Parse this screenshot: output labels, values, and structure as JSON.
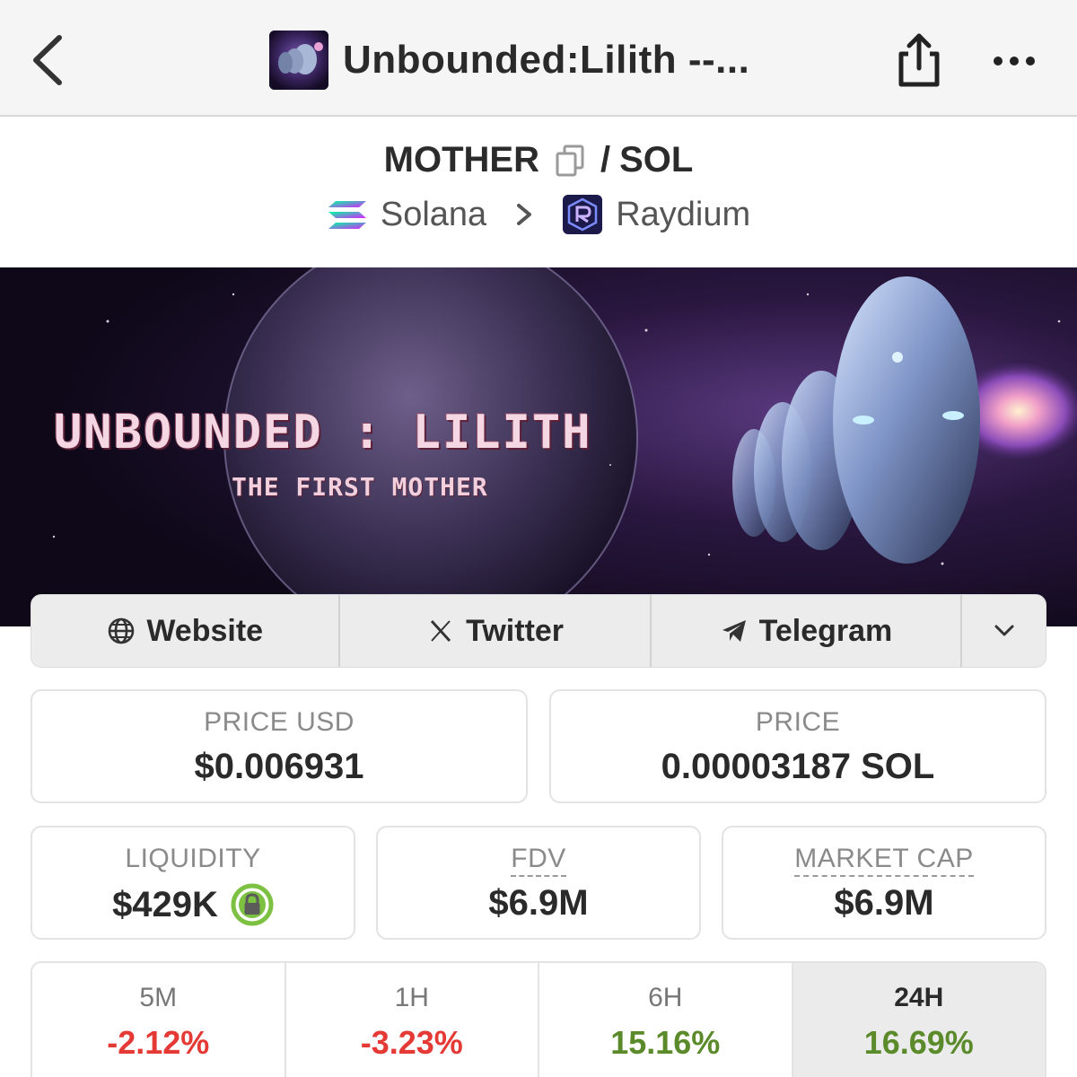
{
  "nav": {
    "title": "Unbounded:Lilith --...",
    "back_icon": "chevron-left-icon",
    "share_icon": "share-icon",
    "more_icon": "more-horizontal-icon"
  },
  "pair": {
    "base": "MOTHER",
    "separator": "/",
    "quote": "SOL",
    "chain": "Solana",
    "dex": "Raydium"
  },
  "banner": {
    "title": "UNBOUNDED : LILITH",
    "subtitle": "THE FIRST MOTHER"
  },
  "links": {
    "website": "Website",
    "twitter": "Twitter",
    "telegram": "Telegram"
  },
  "stats": {
    "price_usd_label": "PRICE USD",
    "price_usd": "$0.006931",
    "price_label": "PRICE",
    "price_sol": "0.00003187 SOL",
    "liquidity_label": "LIQUIDITY",
    "liquidity": "$429K",
    "fdv_label": "FDV",
    "fdv": "$6.9M",
    "mcap_label": "MARKET CAP",
    "mcap": "$6.9M"
  },
  "changes": [
    {
      "label": "5M",
      "value": "-2.12%"
    },
    {
      "label": "1H",
      "value": "-3.23%"
    },
    {
      "label": "6H",
      "value": "15.16%"
    },
    {
      "label": "24H",
      "value": "16.69%"
    }
  ],
  "colors": {
    "negative": "#e53935",
    "positive": "#5b8a2a",
    "lock_green": "#7cc142"
  }
}
